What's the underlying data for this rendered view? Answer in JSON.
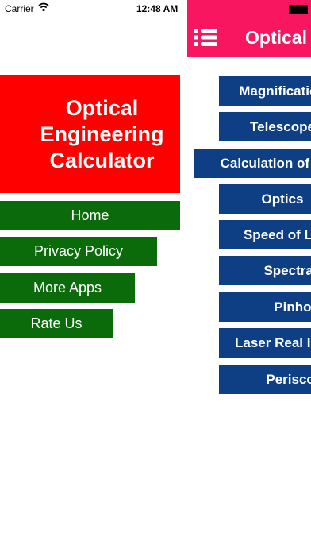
{
  "status_bar": {
    "carrier": "Carrier",
    "time": "12:48 AM"
  },
  "drawer": {
    "title": "Optical Engineering Calculator",
    "header_color": "#ff0000",
    "item_color": "#0b6b0b",
    "items": [
      {
        "label": "Home"
      },
      {
        "label": "Privacy Policy"
      },
      {
        "label": "More Apps"
      },
      {
        "label": "Rate Us"
      }
    ]
  },
  "main": {
    "title": "Optical Engineering Calculator",
    "header_color": "#f7165f",
    "button_color": "#0e3f84",
    "buttons": [
      {
        "label": "Magnification"
      },
      {
        "label": "Telescope"
      },
      {
        "label": "Calculation of Lens"
      },
      {
        "label": "Optics"
      },
      {
        "label": "Speed of Light"
      },
      {
        "label": "Spectral"
      },
      {
        "label": "Pinhole"
      },
      {
        "label": "Laser Real Intensity"
      },
      {
        "label": "Periscope"
      }
    ]
  },
  "icons": {
    "wifi": "wifi-icon",
    "menu": "menu-list-icon",
    "battery": "battery-icon"
  }
}
